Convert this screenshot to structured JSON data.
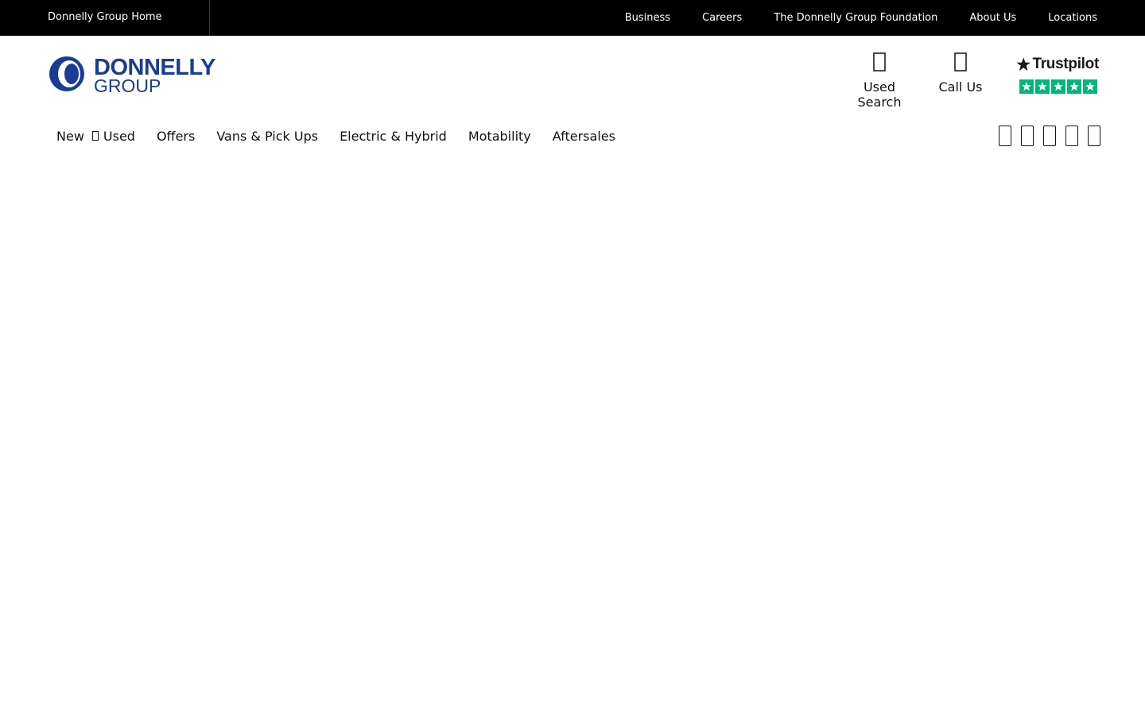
{
  "topbar": {
    "home_label": "Donnelly Group Home",
    "links": [
      "Business",
      "Careers",
      "The Donnelly Group Foundation",
      "About Us",
      "Locations"
    ]
  },
  "logo": {
    "line1": "DONNELLY",
    "line2": "GROUP",
    "brand_color": "#1a3c96"
  },
  "header": {
    "used_search_label": "Used Search",
    "used_search_icon": "search-icon",
    "call_us_label": "Call Us",
    "call_us_icon": "phone-icon"
  },
  "trustpilot": {
    "name": "Trustpilot",
    "stars": 5,
    "star_color": "#00b67a"
  },
  "nav": {
    "items": [
      "New",
      "Used",
      "Offers",
      "Vans & Pick Ups",
      "Electric & Hybrid",
      "Motability",
      "Aftersales"
    ]
  },
  "socials": [
    "facebook-icon",
    "twitter-icon",
    "instagram-icon",
    "youtube-icon",
    "linkedin-icon"
  ]
}
